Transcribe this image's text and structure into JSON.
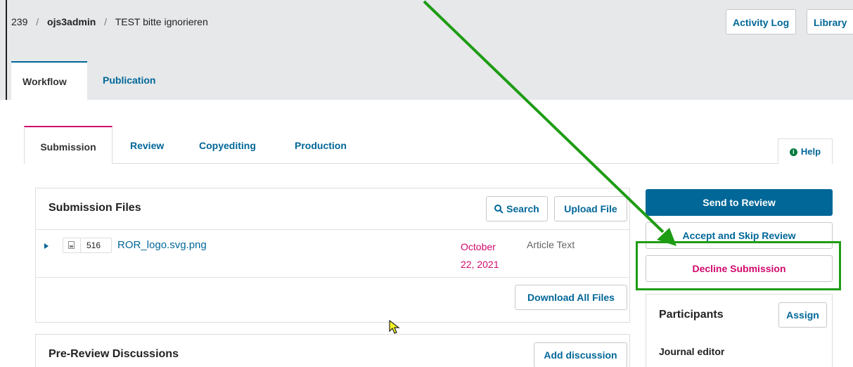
{
  "breadcrumb": {
    "id": "239",
    "author": "ojs3admin",
    "title": "TEST bitte ignorieren"
  },
  "top_actions": {
    "activity_log": "Activity Log",
    "library": "Library"
  },
  "publication_tabs": {
    "workflow": "Workflow",
    "publication": "Publication"
  },
  "stage_tabs": {
    "submission": "Submission",
    "review": "Review",
    "copyediting": "Copyediting",
    "production": "Production",
    "help": "Help"
  },
  "submission_files": {
    "title": "Submission Files",
    "search": "Search",
    "upload": "Upload File",
    "download_all": "Download All Files",
    "files": [
      {
        "id": "516",
        "name": "ROR_logo.svg.png",
        "date": "October 22, 2021",
        "type": "Article Text"
      }
    ]
  },
  "discussions": {
    "title": "Pre-Review Discussions",
    "add": "Add discussion"
  },
  "decisions": {
    "send_to_review": "Send to Review",
    "accept_skip": "Accept and Skip Review",
    "decline": "Decline Submission"
  },
  "participants": {
    "title": "Participants",
    "assign": "Assign",
    "role": "Journal editor"
  },
  "colors": {
    "brand": "#006798",
    "accent": "#d00a6c",
    "annotation": "#1e9c14"
  }
}
